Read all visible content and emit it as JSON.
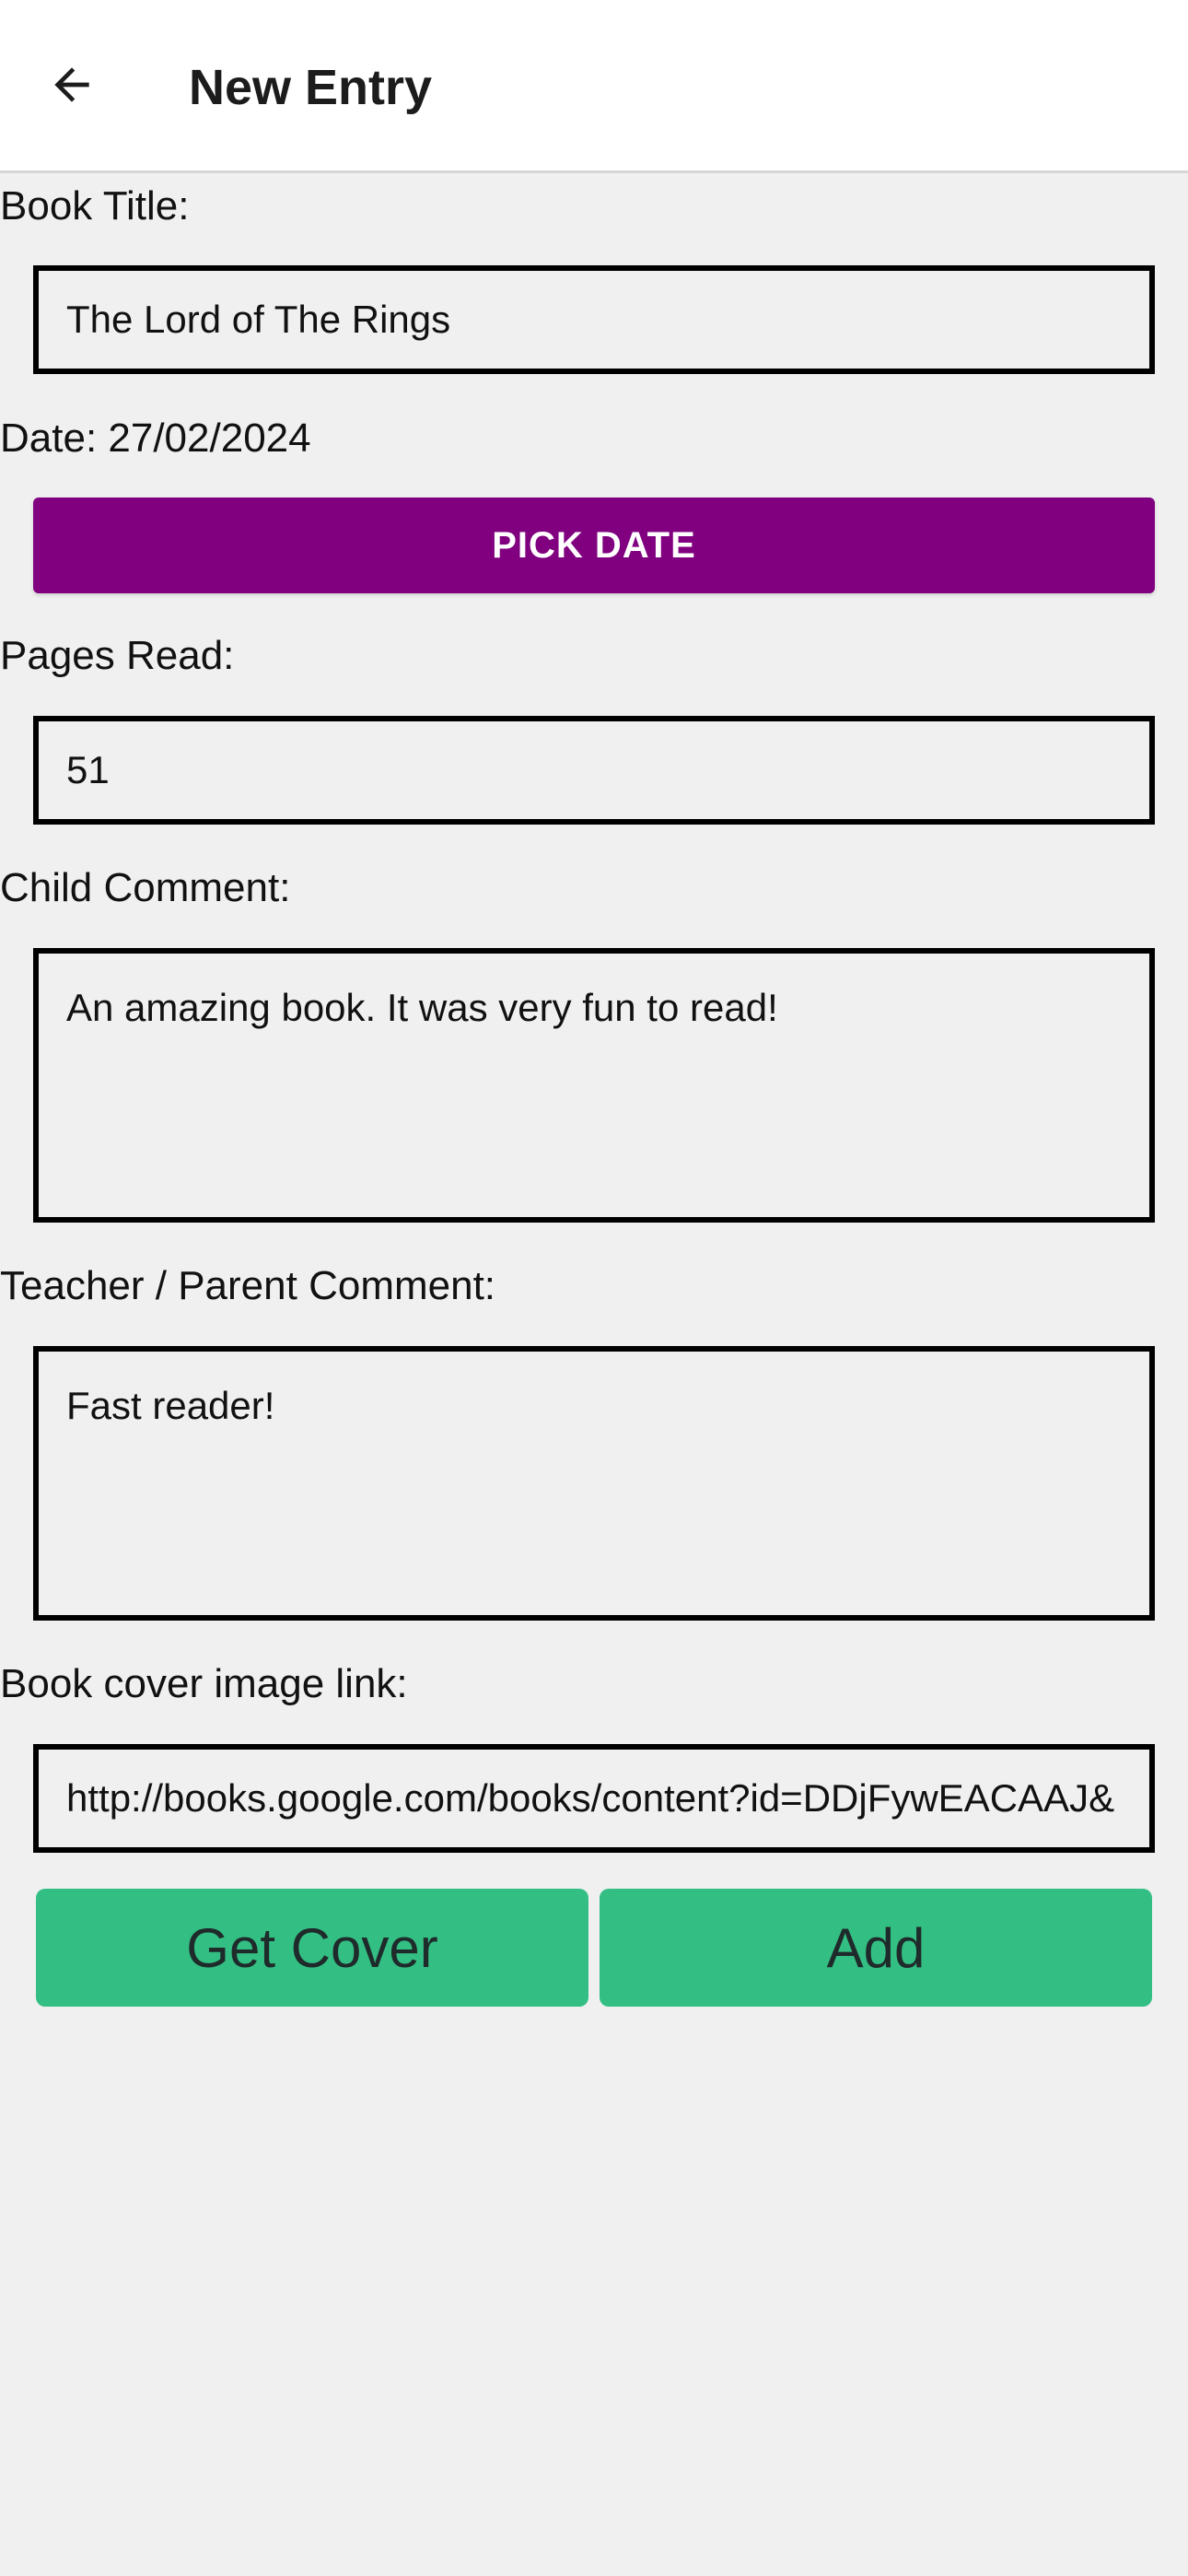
{
  "appbar": {
    "back_icon": "arrow-left-icon",
    "title": "New Entry"
  },
  "form": {
    "book_title_label": "Book Title:",
    "book_title_value": "The Lord of The Rings",
    "date_label": "Date: 27/02/2024",
    "pick_date_label": "PICK DATE",
    "pick_date_color": "#800080",
    "pages_read_label": "Pages Read:",
    "pages_read_value": "51",
    "child_comment_label": "Child Comment:",
    "child_comment_value": "An amazing book. It was very fun to read!",
    "teacher_comment_label": "Teacher / Parent Comment:",
    "teacher_comment_value": "Fast reader!",
    "cover_link_label": "Book cover image link:",
    "cover_link_value": "http://books.google.com/books/content?id=DDjFywEACAAJ&"
  },
  "actions": {
    "get_cover_label": "Get Cover",
    "add_label": "Add",
    "button_color": "#33bf84"
  }
}
